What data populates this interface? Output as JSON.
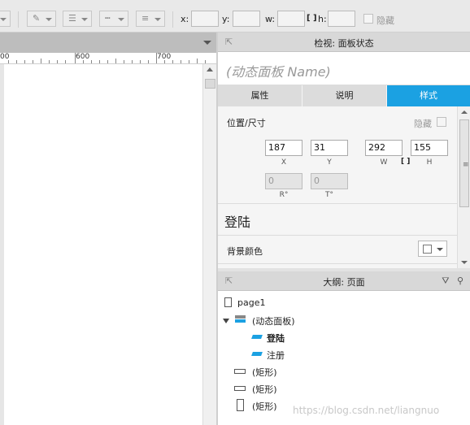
{
  "toolbar": {
    "x_label": "x:",
    "y_label": "y:",
    "w_label": "w:",
    "h_label": "h:",
    "hide_label": "隐藏",
    "x_value": "",
    "y_value": "",
    "w_value": "",
    "h_value": ""
  },
  "ruler": {
    "ticks": [
      "00",
      "600",
      "700"
    ]
  },
  "inspector": {
    "title": "检视: 面板状态",
    "name_placeholder": "(动态面板 Name)",
    "tabs": [
      {
        "label": "属性",
        "active": false
      },
      {
        "label": "说明",
        "active": false
      },
      {
        "label": "样式",
        "active": true
      }
    ],
    "section_pos": "位置/尺寸",
    "hide_label": "隐藏",
    "fields": {
      "x": "187",
      "y": "31",
      "w": "292",
      "h": "155",
      "r": "0",
      "t": "0",
      "x_cap": "X",
      "y_cap": "Y",
      "w_cap": "W",
      "h_cap": "H",
      "r_cap": "R°",
      "t_cap": "T°"
    },
    "state_name": "登陆",
    "bg_color_label": "背景颜色",
    "bg_color": "#ffffff"
  },
  "outline": {
    "title": "大纲: 页面",
    "items": [
      {
        "label": "page1",
        "icon": "page-icon"
      },
      {
        "label": "(动态面板)",
        "icon": "dynamic-panel-icon"
      },
      {
        "label": "登陆",
        "icon": "state-icon"
      },
      {
        "label": "注册",
        "icon": "state-icon"
      },
      {
        "label": "(矩形)",
        "icon": "rectangle-icon"
      },
      {
        "label": "(矩形)",
        "icon": "rectangle-icon"
      },
      {
        "label": "(矩形)",
        "icon": "rectangle-icon"
      }
    ]
  },
  "watermark": "https://blog.csdn.net/liangnuo",
  "colors": {
    "accent": "#1ba1e2"
  }
}
